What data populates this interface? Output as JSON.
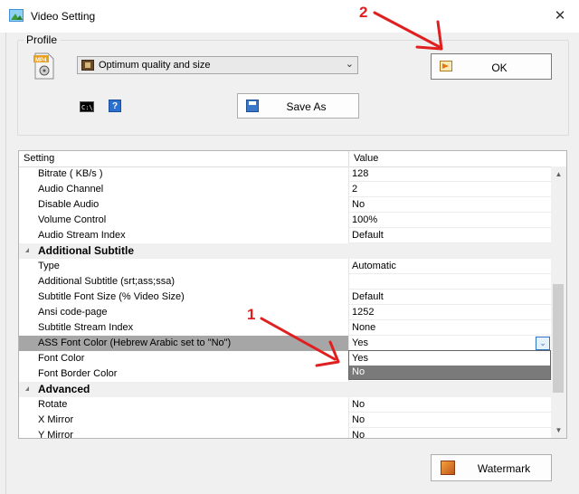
{
  "window": {
    "title": "Video Setting",
    "close_glyph": "✕"
  },
  "profile": {
    "group_label": "Profile",
    "selected_profile": "Optimum quality and size",
    "save_as_label": "Save As",
    "ok_label": "OK",
    "icons": [
      "mp4-file-icon",
      "command-line-icon",
      "help-icon",
      "film-icon",
      "save-disk-icon",
      "ok-arrow-icon"
    ]
  },
  "grid": {
    "headers": {
      "setting": "Setting",
      "value": "Value"
    },
    "rows": [
      {
        "type": "prop",
        "name": "Bitrate ( KB/s )",
        "value": "128"
      },
      {
        "type": "prop",
        "name": "Audio Channel",
        "value": "2"
      },
      {
        "type": "prop",
        "name": "Disable Audio",
        "value": "No"
      },
      {
        "type": "prop",
        "name": "Volume Control",
        "value": "100%"
      },
      {
        "type": "prop",
        "name": "Audio Stream Index",
        "value": "Default"
      },
      {
        "type": "category",
        "name": "Additional Subtitle",
        "value": ""
      },
      {
        "type": "prop",
        "name": "Type",
        "value": "Automatic"
      },
      {
        "type": "prop",
        "name": "Additional Subtitle (srt;ass;ssa)",
        "value": ""
      },
      {
        "type": "prop",
        "name": "Subtitle Font Size (% Video Size)",
        "value": "Default"
      },
      {
        "type": "prop",
        "name": "Ansi code-page",
        "value": "1252"
      },
      {
        "type": "prop",
        "name": "Subtitle Stream Index",
        "value": "None"
      },
      {
        "type": "selected",
        "name": "ASS Font Color (Hebrew Arabic set to \"No\")",
        "value": "Yes"
      },
      {
        "type": "prop",
        "name": "Font Color",
        "value": ""
      },
      {
        "type": "prop",
        "name": "Font Border Color",
        "value": ""
      },
      {
        "type": "category",
        "name": "Advanced",
        "value": ""
      },
      {
        "type": "prop",
        "name": "Rotate",
        "value": "No"
      },
      {
        "type": "prop",
        "name": "X Mirror",
        "value": "No"
      },
      {
        "type": "prop",
        "name": "Y Mirror",
        "value": "No"
      }
    ],
    "dropdown_options": [
      "Yes",
      "No"
    ],
    "dropdown_highlighted": "No"
  },
  "watermark_label": "Watermark",
  "annotations": {
    "label_1": "1",
    "label_2": "2",
    "color": "#e02020"
  }
}
